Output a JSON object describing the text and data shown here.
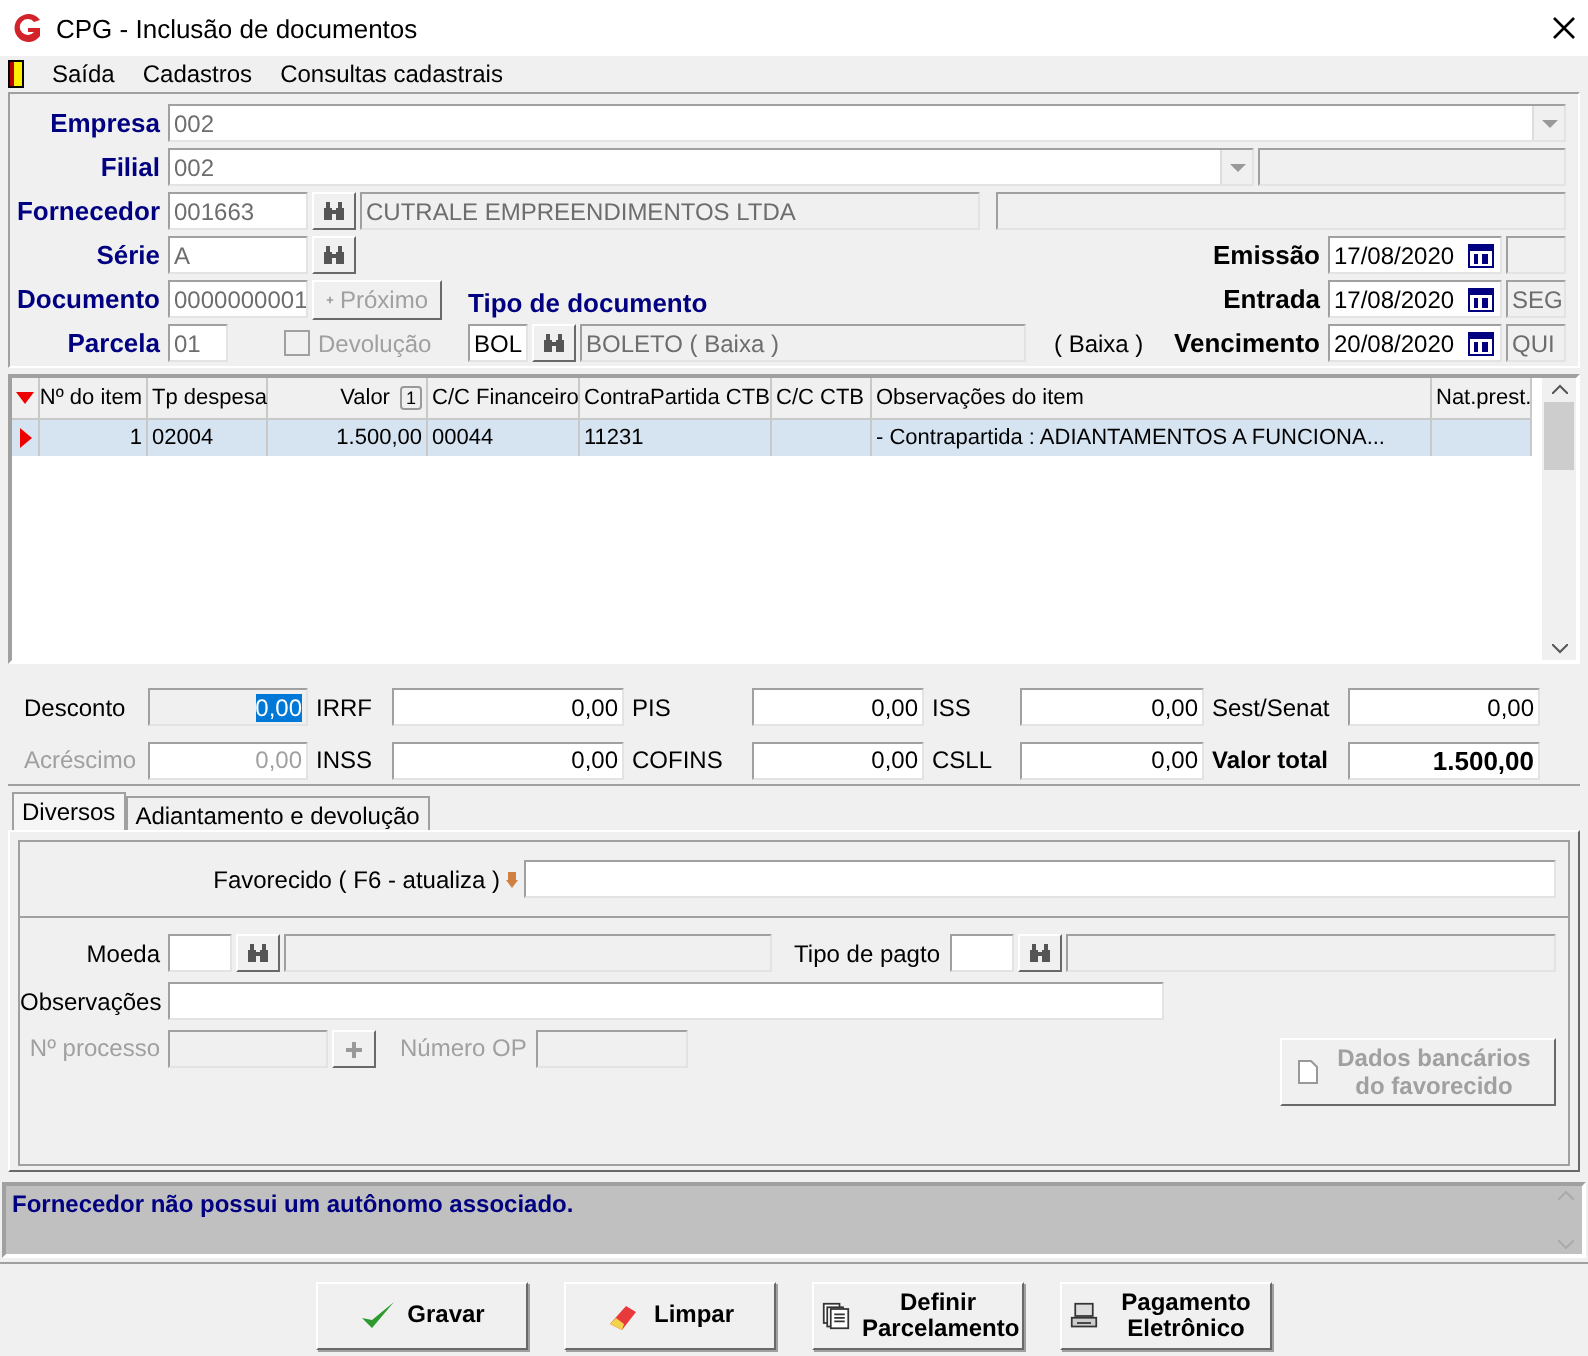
{
  "window": {
    "title": "CPG - Inclusão de documentos"
  },
  "menu": [
    "Saída",
    "Cadastros",
    "Consultas cadastrais"
  ],
  "header": {
    "empresa": {
      "label": "Empresa",
      "value": "002",
      "disabled": true
    },
    "filial": {
      "label": "Filial",
      "value": "002",
      "disabled": true
    },
    "fornecedor": {
      "label": "Fornecedor",
      "code": "001663",
      "name": "CUTRALE EMPREENDIMENTOS LTDA",
      "disabled": true
    },
    "serie": {
      "label": "Série",
      "value": "A",
      "disabled": true
    },
    "documento": {
      "label": "Documento",
      "value": "0000000001",
      "disabled": true
    },
    "next_button": {
      "label": "Próximo",
      "disabled": true
    },
    "parcela": {
      "label": "Parcela",
      "value": "01",
      "disabled": true
    },
    "devolucao": {
      "label": "Devolução",
      "checked": false,
      "disabled": true
    },
    "tipo_documento": {
      "label": "Tipo de documento",
      "code": "BOL",
      "name": "BOLETO ( Baixa )",
      "note": "( Baixa )",
      "disabled": false
    },
    "dates": [
      {
        "label": "Emissão",
        "value": "17/08/2020"
      },
      {
        "label": "Entrada",
        "value": "17/08/2020",
        "weekday": "SEG"
      },
      {
        "label": "Vencimento",
        "value": "20/08/2020",
        "weekday": "QUI"
      }
    ]
  },
  "items": {
    "columns": [
      {
        "label": "Nº do item"
      },
      {
        "label": "Tp despesa"
      },
      {
        "label": "Valor",
        "sort": "1"
      },
      {
        "label": "C/C Financeiro"
      },
      {
        "label": "ContraPartida CTB"
      },
      {
        "label": "C/C CTB"
      },
      {
        "label": "Observações do item"
      },
      {
        "label": "Nat.prest."
      }
    ],
    "rows": [
      {
        "selected": true,
        "cells": [
          "1",
          "02004",
          "1.500,00",
          "00044",
          "11231",
          "",
          "- Contrapartida : ADIANTAMENTOS A FUNCIONA...",
          ""
        ]
      }
    ]
  },
  "totals": [
    {
      "label": "Desconto",
      "value": "0,00",
      "disabled": false,
      "text_selected": true,
      "kind": "field"
    },
    {
      "label": "IRRF",
      "value": "0,00",
      "disabled": false,
      "text_selected": false,
      "kind": "field"
    },
    {
      "label": "PIS",
      "value": "0,00",
      "disabled": false,
      "text_selected": false,
      "kind": "field"
    },
    {
      "label": "ISS",
      "value": "0,00",
      "disabled": false,
      "text_selected": false,
      "kind": "field"
    },
    {
      "label": "Sest/Senat",
      "value": "0,00",
      "disabled": false,
      "text_selected": false,
      "kind": "field"
    },
    {
      "label": "Acréscimo",
      "value": "0,00",
      "disabled": true,
      "text_selected": false,
      "kind": "field"
    },
    {
      "label": "INSS",
      "value": "0,00",
      "disabled": false,
      "text_selected": false,
      "kind": "field"
    },
    {
      "label": "COFINS",
      "value": "0,00",
      "disabled": false,
      "text_selected": false,
      "kind": "field"
    },
    {
      "label": "CSLL",
      "value": "0,00",
      "disabled": false,
      "text_selected": false,
      "kind": "field"
    },
    {
      "label": "Valor total",
      "value": "1.500,00",
      "disabled": false,
      "text_selected": false,
      "kind": "total"
    }
  ],
  "tabs": [
    {
      "label": "Diversos",
      "selected": true
    },
    {
      "label": "Adiantamento e devolução",
      "selected": false
    }
  ],
  "diversos": {
    "favorecido": {
      "label": "Favorecido ( F6 - atualiza )"
    },
    "moeda": {
      "label": "Moeda"
    },
    "tipo_pagto": {
      "label": "Tipo de pagto"
    },
    "observacoes": {
      "label": "Observações"
    },
    "processo": {
      "label": "Nº processo",
      "disabled": true
    },
    "numero_op": {
      "label": "Número OP",
      "disabled": true
    },
    "bank_button": {
      "label": "Dados bancários do favorecido",
      "disabled": true
    }
  },
  "message": "Fornecedor não possui um autônomo associado.",
  "buttons": [
    {
      "label": "Gravar",
      "kind": "check"
    },
    {
      "label": "Limpar",
      "kind": "eraser"
    },
    {
      "label": "Definir Parcelamento",
      "kind": "pages"
    },
    {
      "label": "Pagamento Eletrônico",
      "kind": "printer"
    }
  ]
}
